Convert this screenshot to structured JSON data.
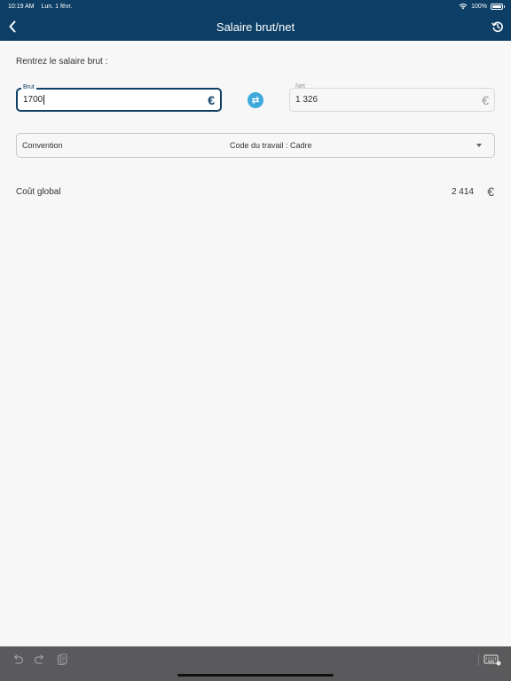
{
  "status_bar": {
    "time": "10:19 AM",
    "date": "Lun. 1 févr.",
    "battery": "100%"
  },
  "nav": {
    "title": "Salaire brut/net",
    "back_icon": "chevron-left-icon",
    "history_icon": "history-icon"
  },
  "form": {
    "prompt": "Rentrez le salaire brut :",
    "brut": {
      "label": "Brut",
      "value": "1700",
      "currency": "€"
    },
    "net": {
      "label": "Net",
      "value": "1 326",
      "currency": "€"
    },
    "swap_icon": "swap-arrows-icon",
    "convention": {
      "label": "Convention",
      "value": "Code du travail : Cadre"
    }
  },
  "cost": {
    "label": "Coût global",
    "value": "2 414",
    "currency": "€"
  },
  "toolbar": {
    "undo_icon": "undo-icon",
    "redo_icon": "redo-icon",
    "paste_icon": "clipboard-icon",
    "keyboard_icon": "keyboard-icon"
  },
  "colors": {
    "primary": "#0d3f66",
    "accent": "#3fa9dc",
    "background": "#f7f7f8",
    "toolbar": "#5a5a5c"
  }
}
